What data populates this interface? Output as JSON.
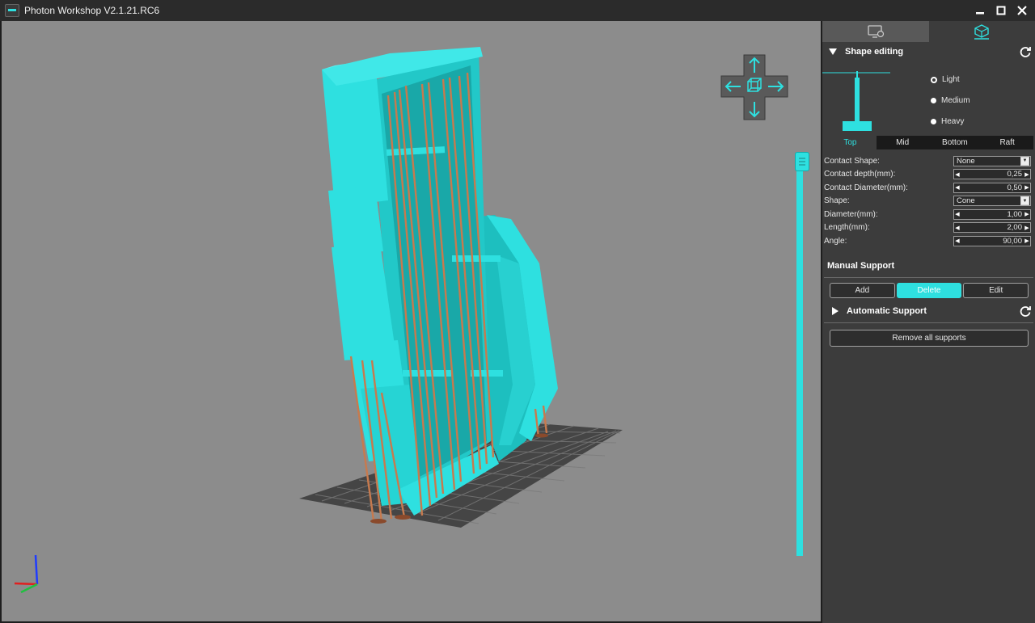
{
  "window": {
    "title": "Photon Workshop V2.1.21.RC6"
  },
  "icons": {
    "app": "app-icon",
    "minimize": "minimize-icon",
    "maximize": "maximize-icon",
    "close": "close-icon"
  },
  "colors": {
    "accent": "#2ee0e0",
    "panel": "#3c3c3c",
    "viewport": "#8c8c8c",
    "support": "#c77a4e"
  },
  "panel": {
    "tabs": [
      {
        "icon": "print-settings-icon",
        "active": false
      },
      {
        "icon": "support-model-icon",
        "active": true
      }
    ],
    "shape_editing": {
      "title": "Shape editing",
      "presets": [
        {
          "label": "Light",
          "selected": true
        },
        {
          "label": "Medium",
          "selected": false
        },
        {
          "label": "Heavy",
          "selected": false
        }
      ],
      "subtabs": [
        {
          "label": "Top",
          "active": true
        },
        {
          "label": "Mid",
          "active": false
        },
        {
          "label": "Bottom",
          "active": false
        },
        {
          "label": "Raft",
          "active": false
        }
      ],
      "params": [
        {
          "label": "Contact Shape:",
          "type": "select",
          "value": "None"
        },
        {
          "label": "Contact depth(mm):",
          "type": "spin",
          "value": "0,25"
        },
        {
          "label": "Contact Diameter(mm):",
          "type": "spin",
          "value": "0,50"
        },
        {
          "label": "Shape:",
          "type": "select",
          "value": "Cone"
        },
        {
          "label": "Diameter(mm):",
          "type": "spin",
          "value": "1,00"
        },
        {
          "label": "Length(mm):",
          "type": "spin",
          "value": "2,00"
        },
        {
          "label": "Angle:",
          "type": "spin",
          "value": "90,00"
        }
      ]
    },
    "manual_support": {
      "title": "Manual Support",
      "buttons": [
        {
          "label": "Add",
          "active": false
        },
        {
          "label": "Delete",
          "active": true
        },
        {
          "label": "Edit",
          "active": false
        }
      ]
    },
    "automatic_support": {
      "title": "Automatic Support"
    },
    "remove_all_label": "Remove all supports"
  },
  "viewport": {
    "nav_cube": {
      "icons": [
        "arrow-up-icon",
        "arrow-left-icon",
        "arrow-right-icon",
        "arrow-down-icon",
        "view-cube-icon"
      ]
    },
    "layer_slider": {
      "position": 1.0
    }
  }
}
